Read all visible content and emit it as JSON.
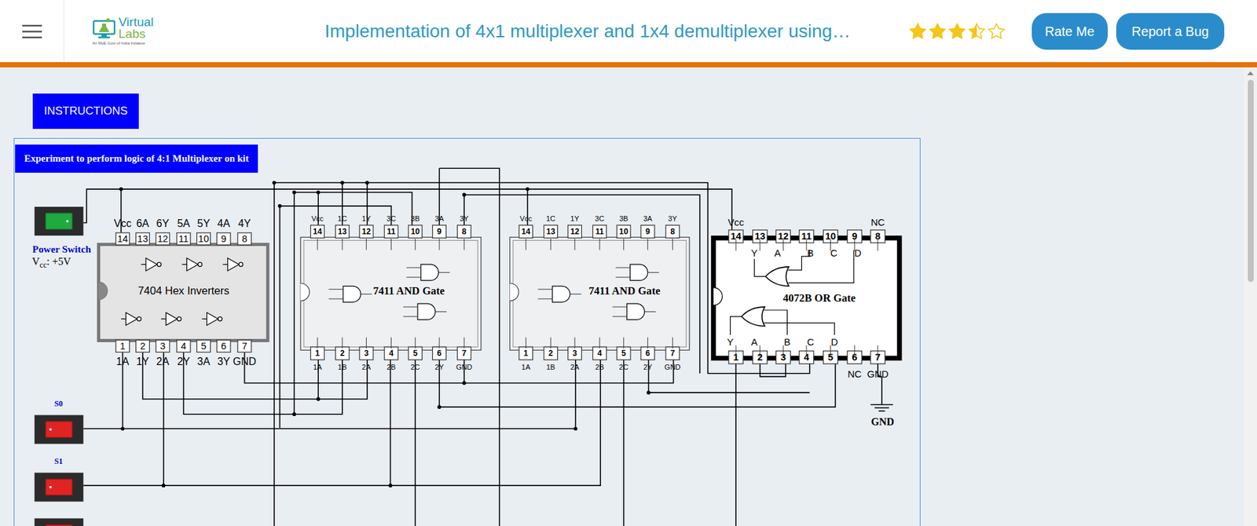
{
  "header": {
    "logo": {
      "word_1": "Virtual",
      "word_2": "Labs",
      "tagline": "An MoE Govt of India Initiative"
    },
    "title": "Implementation of 4x1 multiplexer and 1x4 demultiplexer using…",
    "stars": 3.5,
    "buttons": [
      "Rate Me",
      "Report a Bug"
    ]
  },
  "instructions_button": "INSTRUCTIONS",
  "experiment": {
    "title": "Experiment to perform logic of 4:1 Multiplexer on kit",
    "switches": [
      {
        "label": "Power Switch",
        "on": true
      },
      {
        "label": "S0",
        "on": false
      },
      {
        "label": "S1",
        "on": false
      },
      {
        "on": false
      }
    ],
    "supply": {
      "symbol": "V",
      "subscript": "cc",
      "value": ": +5V"
    },
    "ground_label": "GND",
    "chips": [
      {
        "name": "7404 Hex Inverters",
        "kind": "inverter",
        "top_pins": [
          {
            "number": "14",
            "label": "Vcc"
          },
          {
            "number": "13",
            "label": "6A"
          },
          {
            "number": "12",
            "label": "6Y"
          },
          {
            "number": "11",
            "label": "5A"
          },
          {
            "number": "10",
            "label": "5Y"
          },
          {
            "number": "9",
            "label": "4A"
          },
          {
            "number": "8",
            "label": "4Y"
          }
        ],
        "bottom_pins": [
          {
            "number": "1",
            "label": "1A"
          },
          {
            "number": "2",
            "label": "1Y"
          },
          {
            "number": "3",
            "label": "2A"
          },
          {
            "number": "4",
            "label": "2Y"
          },
          {
            "number": "5",
            "label": "3A"
          },
          {
            "number": "6",
            "label": "3Y"
          },
          {
            "number": "7",
            "label": "GND"
          }
        ]
      },
      {
        "name": "7411 AND Gate",
        "kind": "and",
        "top_pins": [
          {
            "number": "14",
            "label": "Vcc"
          },
          {
            "number": "13",
            "label": "1C"
          },
          {
            "number": "12",
            "label": "1Y"
          },
          {
            "number": "11",
            "label": "3C"
          },
          {
            "number": "10",
            "label": "3B"
          },
          {
            "number": "9",
            "label": "3A"
          },
          {
            "number": "8",
            "label": "3Y"
          }
        ],
        "bottom_pins": [
          {
            "number": "1",
            "label": "1A"
          },
          {
            "number": "2",
            "label": "1B"
          },
          {
            "number": "3",
            "label": "2A"
          },
          {
            "number": "4",
            "label": "2B"
          },
          {
            "number": "5",
            "label": "2C"
          },
          {
            "number": "6",
            "label": "2Y"
          },
          {
            "number": "7",
            "label": "GND"
          }
        ]
      },
      {
        "name": "7411 AND Gate",
        "kind": "and",
        "top_pins": [
          {
            "number": "14",
            "label": "Vcc"
          },
          {
            "number": "13",
            "label": "1C"
          },
          {
            "number": "12",
            "label": "1Y"
          },
          {
            "number": "11",
            "label": "3C"
          },
          {
            "number": "10",
            "label": "3B"
          },
          {
            "number": "9",
            "label": "3A"
          },
          {
            "number": "8",
            "label": "3Y"
          }
        ],
        "bottom_pins": [
          {
            "number": "1",
            "label": "1A"
          },
          {
            "number": "2",
            "label": "1B"
          },
          {
            "number": "3",
            "label": "2A"
          },
          {
            "number": "4",
            "label": "2B"
          },
          {
            "number": "5",
            "label": "2C"
          },
          {
            "number": "6",
            "label": "2Y"
          },
          {
            "number": "7",
            "label": "GND"
          }
        ]
      },
      {
        "name": "4072B OR Gate",
        "kind": "or",
        "top_pins": [
          {
            "number": "14",
            "label": "Vcc"
          },
          {
            "number": "13"
          },
          {
            "number": "12"
          },
          {
            "number": "11"
          },
          {
            "number": "10"
          },
          {
            "number": "9"
          },
          {
            "number": "8",
            "label": "NC"
          }
        ],
        "bottom_pins": [
          {
            "number": "1"
          },
          {
            "number": "2"
          },
          {
            "number": "3"
          },
          {
            "number": "4"
          },
          {
            "number": "5"
          },
          {
            "number": "6",
            "label": "NC"
          },
          {
            "number": "7",
            "label": "GND"
          }
        ],
        "inner_top": [
          "Y",
          "A",
          "B",
          "C",
          "D"
        ],
        "inner_bottom": [
          "Y",
          "A",
          "B",
          "C",
          "D"
        ]
      }
    ]
  }
}
